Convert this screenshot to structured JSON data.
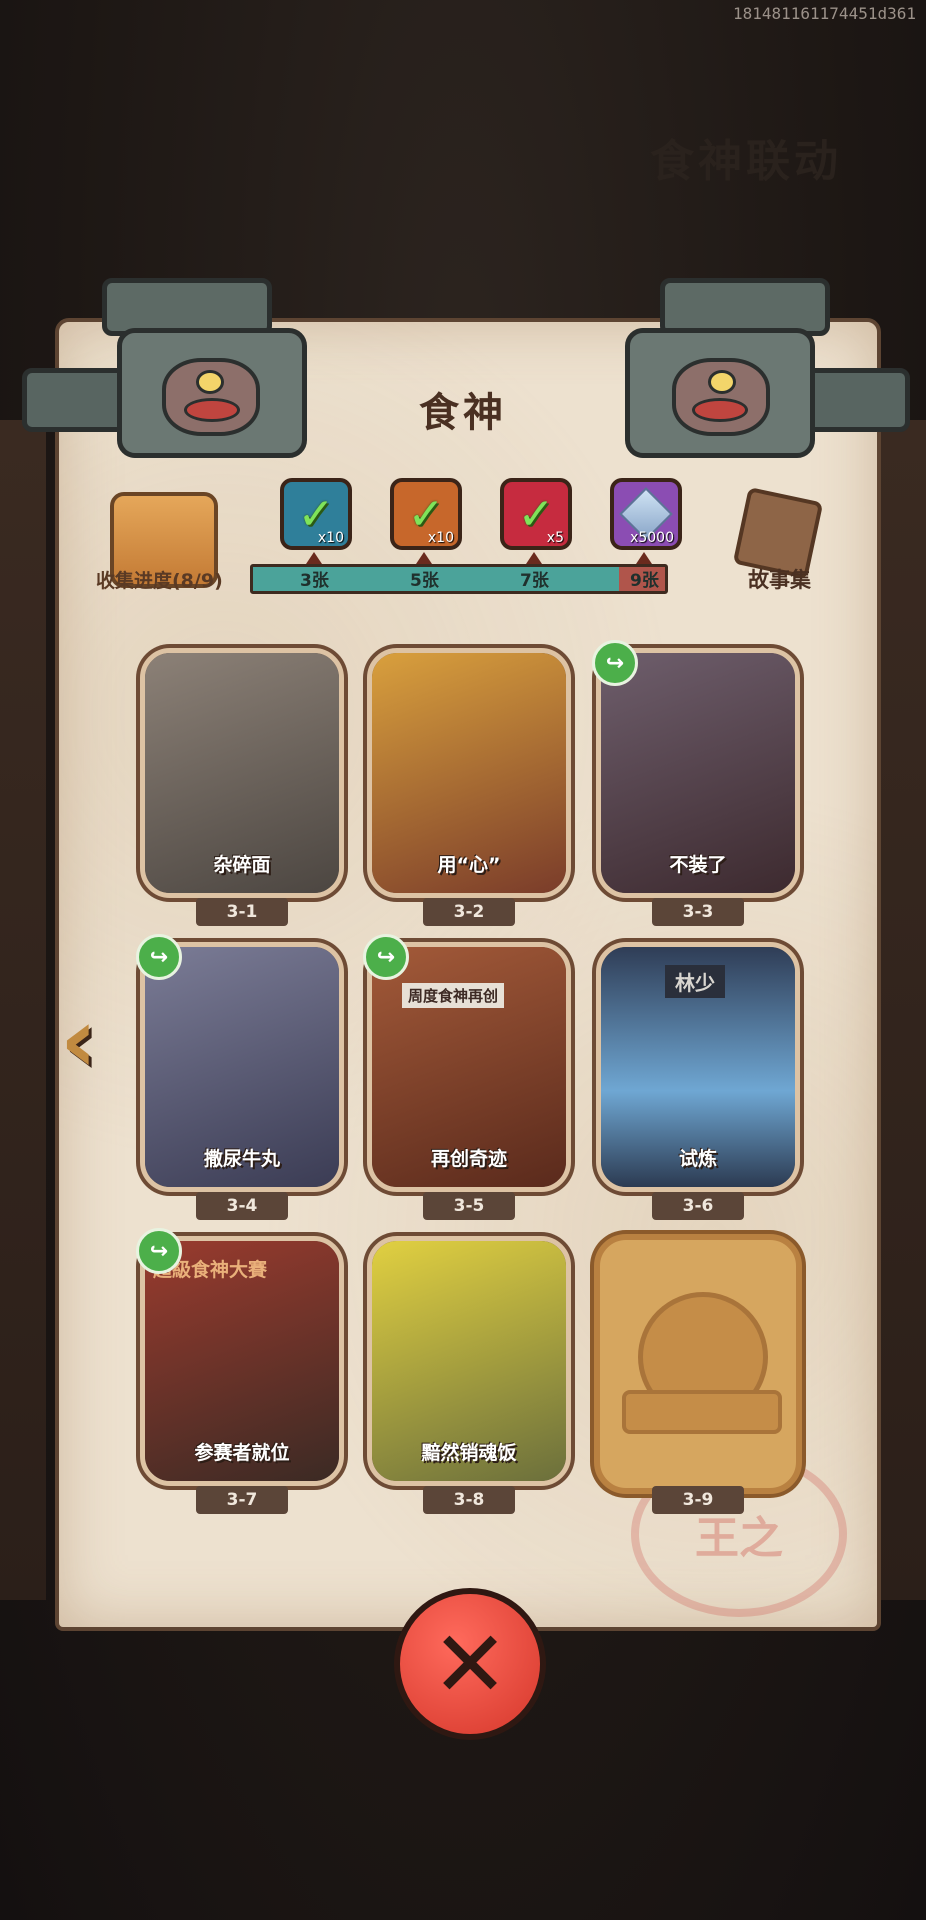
{
  "debug": "181481161174451d361",
  "background_title": "食神联动",
  "title": "食神",
  "progress": {
    "label": "收集进度(8/9)",
    "collected": 8,
    "total": 9,
    "milestones": [
      {
        "label": "3张",
        "reward_qty": "x10",
        "claimed": true,
        "color": "#2f7f9a"
      },
      {
        "label": "5张",
        "reward_qty": "x10",
        "claimed": true,
        "color": "#c7672b"
      },
      {
        "label": "7张",
        "reward_qty": "x5",
        "claimed": true,
        "color": "#c62b3f"
      },
      {
        "label": "9张",
        "reward_qty": "x5000",
        "claimed": false,
        "color": "#8b4db3"
      }
    ]
  },
  "story_label": "故事集",
  "cards": [
    {
      "id": "3-1",
      "caption": "杂碎面",
      "share": false
    },
    {
      "id": "3-2",
      "caption": "用“心”",
      "share": false
    },
    {
      "id": "3-3",
      "caption": "不装了",
      "share": true
    },
    {
      "id": "3-4",
      "caption": "撒尿牛丸",
      "share": true
    },
    {
      "id": "3-5",
      "caption": "再创奇迹",
      "share": true
    },
    {
      "id": "3-6",
      "caption": "试炼",
      "share": false
    },
    {
      "id": "3-7",
      "caption": "参赛者就位",
      "share": true
    },
    {
      "id": "3-8",
      "caption": "黯然销魂饭",
      "share": false
    },
    {
      "id": "3-9",
      "caption": "",
      "share": false,
      "locked": true
    }
  ],
  "card_extra_text": {
    "newspaper": "周度食神再创",
    "door_sign": "林少",
    "contest_banner": "超級食神大賽"
  },
  "stamp_text": "王之",
  "icons": {
    "share": "share-arrow-icon",
    "close": "close-icon",
    "nav": "left-arrow-icon"
  }
}
